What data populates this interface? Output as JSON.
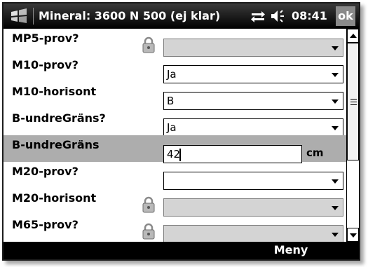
{
  "titlebar": {
    "title": "Mineral: 3600 N 500 (ej klar)",
    "time": "08:41",
    "ok_label": "ok",
    "icons": [
      "windows-start-icon",
      "connectivity-icon",
      "volume-icon"
    ]
  },
  "form": {
    "rows": [
      {
        "label": "MP5-prov?",
        "value": "",
        "locked": true,
        "type": "dropdown"
      },
      {
        "label": "M10-prov?",
        "value": "Ja",
        "locked": false,
        "type": "dropdown"
      },
      {
        "label": "M10-horisont",
        "value": "B",
        "locked": false,
        "type": "dropdown"
      },
      {
        "label": "B-undreGräns?",
        "value": "Ja",
        "locked": false,
        "type": "dropdown"
      },
      {
        "label": "B-undreGräns",
        "value": "42",
        "unit": "cm",
        "locked": false,
        "type": "text",
        "focused": true
      },
      {
        "label": "M20-prov?",
        "value": "",
        "locked": false,
        "type": "dropdown"
      },
      {
        "label": "M20-horisont",
        "value": "",
        "locked": true,
        "type": "dropdown"
      },
      {
        "label": "M65-prov?",
        "value": "",
        "locked": true,
        "type": "dropdown"
      }
    ]
  },
  "softkeys": {
    "right_label": "Meny"
  },
  "colors": {
    "titlebar_bg": "#000000",
    "highlight_row": "#adadad",
    "disabled_field": "#d4d4d4",
    "ok_button": "#8a8a8a"
  }
}
